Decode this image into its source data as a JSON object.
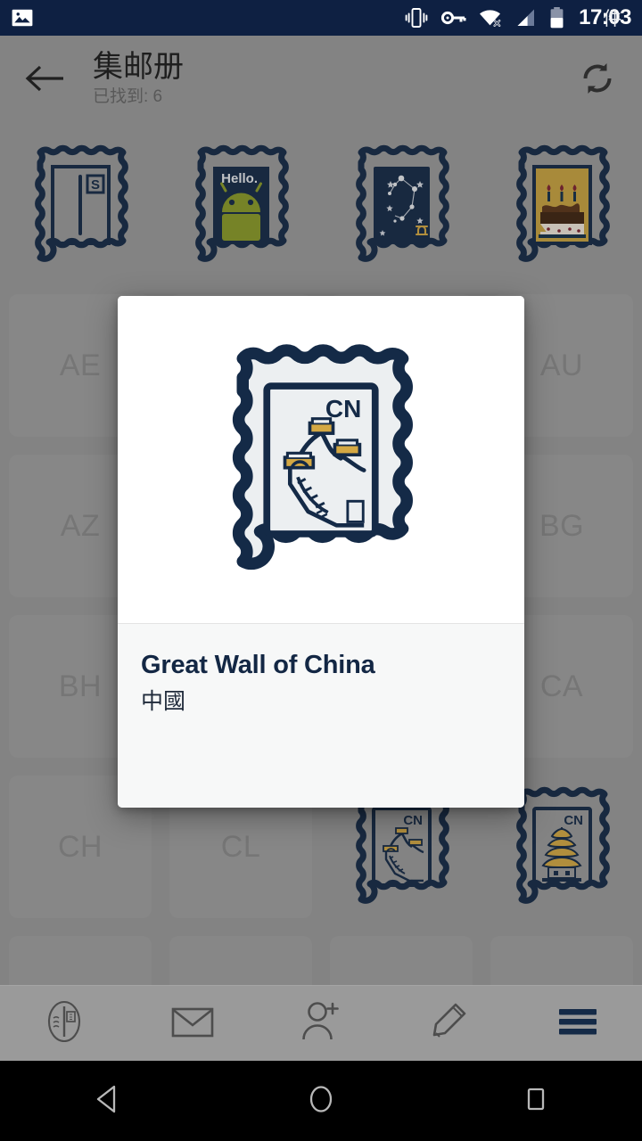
{
  "statusbar": {
    "time": "17:03",
    "overlap_char": "件",
    "icons": [
      "image-icon",
      "vibrate-icon",
      "vpn-key-icon",
      "wifi-off-icon",
      "cellular-signal-icon",
      "battery-icon"
    ]
  },
  "appbar": {
    "back_label": "back-arrow",
    "title": "集邮册",
    "subtitle": "已找到: 6",
    "refresh_label": "refresh"
  },
  "grid": {
    "rows": [
      [
        {
          "type": "stamp",
          "code": "",
          "art": "letter-s"
        },
        {
          "type": "stamp",
          "code": "",
          "art": "android-hello",
          "caption": "Hello."
        },
        {
          "type": "stamp",
          "code": "",
          "art": "constellation-libra"
        },
        {
          "type": "stamp",
          "code": "",
          "art": "birthday-cake"
        }
      ],
      [
        {
          "type": "code",
          "code": "AE"
        },
        {
          "type": "empty",
          "code": ""
        },
        {
          "type": "empty",
          "code": ""
        },
        {
          "type": "code",
          "code": "AU"
        }
      ],
      [
        {
          "type": "code",
          "code": "AZ"
        },
        {
          "type": "empty",
          "code": ""
        },
        {
          "type": "empty",
          "code": ""
        },
        {
          "type": "code",
          "code": "BG"
        }
      ],
      [
        {
          "type": "code",
          "code": "BH"
        },
        {
          "type": "empty",
          "code": ""
        },
        {
          "type": "empty",
          "code": ""
        },
        {
          "type": "code",
          "code": "CA"
        }
      ],
      [
        {
          "type": "code",
          "code": "CH"
        },
        {
          "type": "code",
          "code": "CL"
        },
        {
          "type": "stamp",
          "code": "CN",
          "art": "great-wall"
        },
        {
          "type": "stamp",
          "code": "CN",
          "art": "pagoda"
        }
      ],
      [
        {
          "type": "empty",
          "code": ""
        },
        {
          "type": "empty",
          "code": ""
        },
        {
          "type": "empty",
          "code": ""
        },
        {
          "type": "empty",
          "code": ""
        }
      ]
    ]
  },
  "dialog": {
    "stamp_country_code": "CN",
    "title": "Great Wall of China",
    "subtitle": "中國",
    "art": "great-wall"
  },
  "toolbar": {
    "items": [
      {
        "name": "stamp-album-icon",
        "active": false
      },
      {
        "name": "envelope-icon",
        "active": false
      },
      {
        "name": "add-person-icon",
        "active": false
      },
      {
        "name": "pencil-icon",
        "active": false
      },
      {
        "name": "hamburger-menu-icon",
        "active": true
      }
    ]
  },
  "navbar": {
    "items": [
      "back-triangle-icon",
      "home-circle-icon",
      "recents-square-icon"
    ]
  },
  "colors": {
    "status_bar": "#0e2042",
    "content_bg": "#9a9a9a",
    "stamp_ink": "#142a47",
    "stamp_paper": "#eceff1",
    "accent_gold": "#d4a843",
    "android_green": "#8a9a27",
    "dialog_title": "#132744",
    "nav_bar": "#000000"
  }
}
